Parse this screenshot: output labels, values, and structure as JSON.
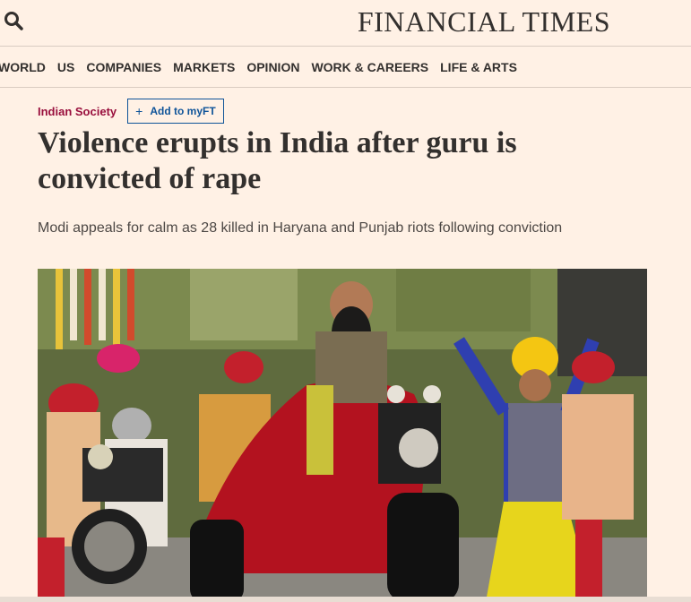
{
  "header": {
    "masthead": "FINANCIAL TIMES",
    "search_icon": "search-icon"
  },
  "nav": {
    "items": [
      {
        "label": "WORLD"
      },
      {
        "label": "US"
      },
      {
        "label": "COMPANIES"
      },
      {
        "label": "MARKETS"
      },
      {
        "label": "OPINION"
      },
      {
        "label": "WORK & CAREERS"
      },
      {
        "label": "LIFE & ARTS"
      }
    ]
  },
  "article": {
    "topic": "Indian Society",
    "myft_label": "Add to myFT",
    "myft_icon": "plus-icon",
    "headline": "Violence erupts in India after guru is convicted of rape",
    "standfirst": "Modi appeals for calm as 28 killed in Haryana and Punjab riots following conviction"
  },
  "colors": {
    "background": "#fff1e5",
    "topic": "#990f3d",
    "myft": "#0f5499",
    "text": "#33302e"
  }
}
